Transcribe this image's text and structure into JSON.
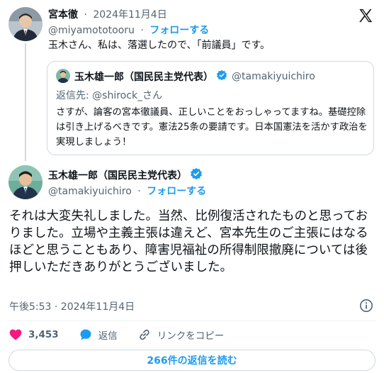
{
  "reply": {
    "name": "宮本徹",
    "date": "2024年11月4日",
    "handle": "@miyamototooru",
    "follow_label": "フォローする",
    "text": "玉木さん、私は、落選したので、「前議員」です。"
  },
  "quote": {
    "name": "玉木雄一郎（国民民主党代表）",
    "handle": "@tamakiyuichiro",
    "reply_to_label": "返信先: ",
    "reply_to_handle": "@shirock_さん",
    "text": "さすが、論客の宮本徹議員、正しいことをおっしゃってますね。基礎控除は引き上げるべきです。憲法25条の要請です。日本国憲法を活かす政治を実現しましょう！"
  },
  "main": {
    "name": "玉木雄一郎（国民民主党代表）",
    "handle": "@tamakiyuichiro",
    "follow_label": "フォローする",
    "text": "それは大変失礼しました。当然、比例復活されたものと思っておりました。立場や主義主張は違えど、宮本先生のご主張にはなるほどと思うこともあり、障害児福祉の所得制限撤廃については後押しいただきありがとうございました。",
    "timestamp": "午後5:53 · 2024年11月4日"
  },
  "actions": {
    "likes": "3,453",
    "reply_label": "返信",
    "copy_link_label": "リンクをコピー"
  },
  "read_replies_label": "266件の返信を読む",
  "separator": "·",
  "colors": {
    "accent": "#1d9bf0",
    "like": "#f91880",
    "muted": "#536471",
    "border": "#cfd9de"
  },
  "icons": [
    "x-logo-icon",
    "verified-badge-icon",
    "info-icon",
    "heart-icon",
    "reply-bubble-icon",
    "link-icon"
  ]
}
